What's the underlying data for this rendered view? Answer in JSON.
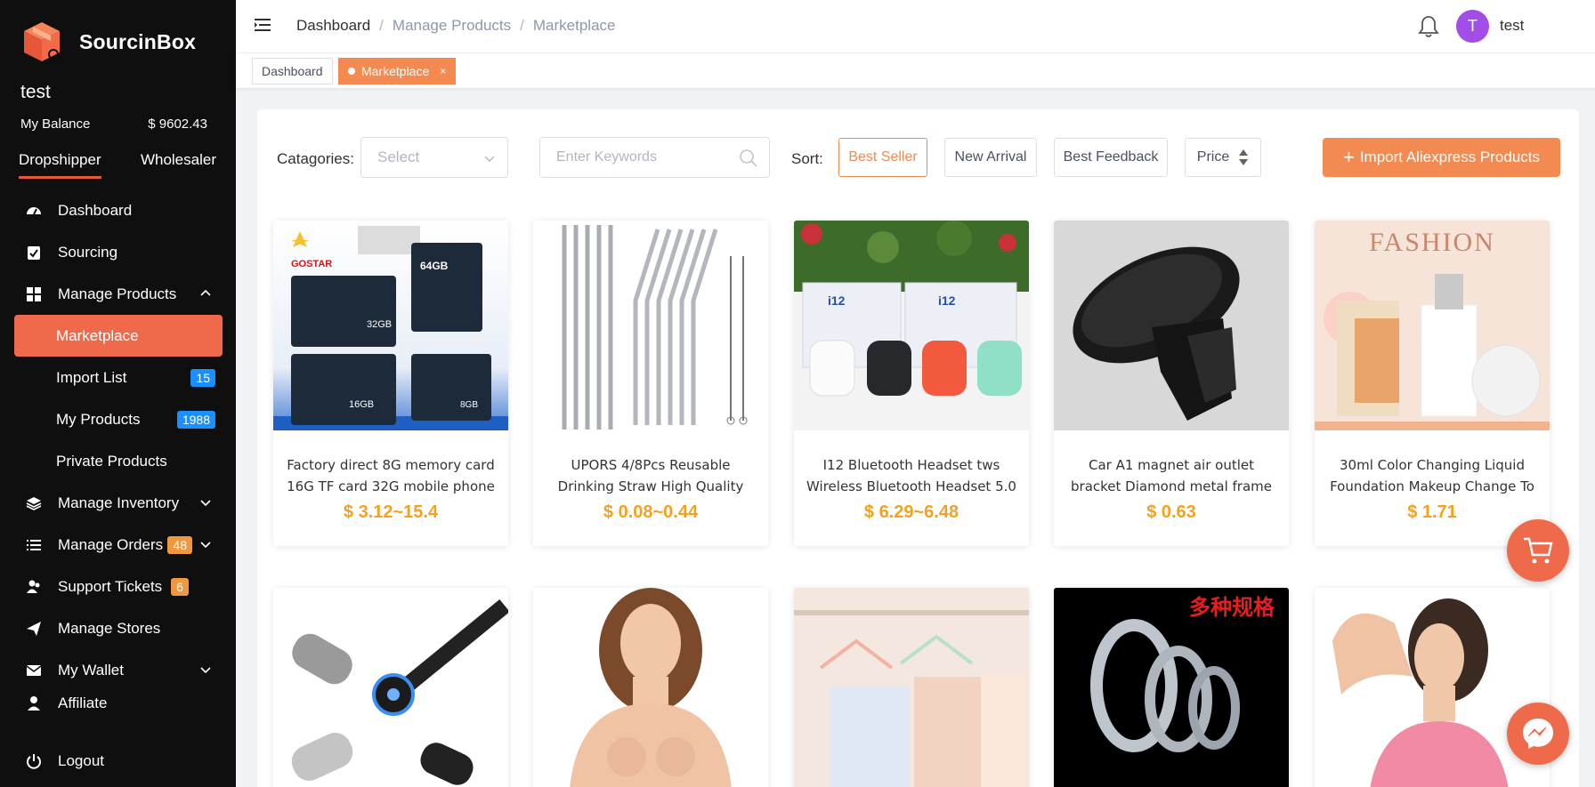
{
  "brand": {
    "name": "SourcinBox",
    "logo_icon": "box-logo-icon",
    "accent": "#ee6a4a"
  },
  "user": {
    "name": "test",
    "balance_label": "My Balance",
    "balance_value": "$ 9602.43",
    "avatar_letter": "T"
  },
  "role_tabs": [
    {
      "label": "Dropshipper",
      "active": true
    },
    {
      "label": "Wholesaler",
      "active": false
    }
  ],
  "menu": [
    {
      "label": "Dashboard",
      "icon": "dashboard-gauge-icon"
    },
    {
      "label": "Sourcing",
      "icon": "clipboard-check-icon"
    },
    {
      "label": "Manage Products",
      "icon": "grid-icon",
      "expanded": true
    },
    {
      "label": "Marketplace",
      "sub": true,
      "active": true
    },
    {
      "label": "Import List",
      "sub": true,
      "badge": "15"
    },
    {
      "label": "My Products",
      "sub": true,
      "badge": "1988"
    },
    {
      "label": "Private Products",
      "sub": true
    },
    {
      "label": "Manage Inventory",
      "icon": "layers-icon"
    },
    {
      "label": "Manage Orders",
      "icon": "list-icon",
      "badge": "48"
    },
    {
      "label": "Support Tickets",
      "icon": "users-icon",
      "badge": "6"
    },
    {
      "label": "Manage Stores",
      "icon": "send-icon"
    },
    {
      "label": "My Wallet",
      "icon": "mail-icon"
    },
    {
      "label": "Affiliate",
      "icon": "user-icon"
    }
  ],
  "logout_label": "Logout",
  "breadcrumb": [
    "Dashboard",
    "Manage Products",
    "Marketplace"
  ],
  "tags": [
    {
      "label": "Dashboard",
      "active": false
    },
    {
      "label": "Marketplace",
      "active": true,
      "close": "×"
    }
  ],
  "filters": {
    "categories_label": "Catagories:",
    "categories_placeholder": "Select",
    "keywords_placeholder": "Enter Keywords",
    "sort_label": "Sort:",
    "sort_options": [
      "Best Seller",
      "New Arrival",
      "Best Feedback",
      "Price"
    ],
    "sort_active": "Best Seller",
    "import_button": "Import Aliexpress Products"
  },
  "products": [
    {
      "title": "Factory direct 8G memory card 16G TF card 32G mobile phone",
      "price": "$ 3.12~15.4"
    },
    {
      "title": "UPORS 4/8Pcs Reusable Drinking Straw High Quality",
      "price": "$ 0.08~0.44"
    },
    {
      "title": "I12 Bluetooth Headset tws Wireless Bluetooth Headset 5.0",
      "price": "$ 6.29~6.48"
    },
    {
      "title": "Car A1 magnet air outlet bracket Diamond metal frame",
      "price": "$ 0.63"
    },
    {
      "title": "30ml Color Changing Liquid Foundation Makeup Change To",
      "price": "$ 1.71"
    }
  ],
  "image_text": {
    "sd_brand": "GOSTAR",
    "sd_64": "64GB",
    "sd_32": "32GB",
    "sd_16": "16GB",
    "sd_8": "8GB",
    "fashion": "FASHION",
    "i12": "i12",
    "chinese": "多种规格"
  },
  "colors": {
    "price": "#f5a11d",
    "sidebar_bg": "#0f0f10",
    "badge_blue": "#1890ff",
    "badge_orange": "#f0973f"
  }
}
